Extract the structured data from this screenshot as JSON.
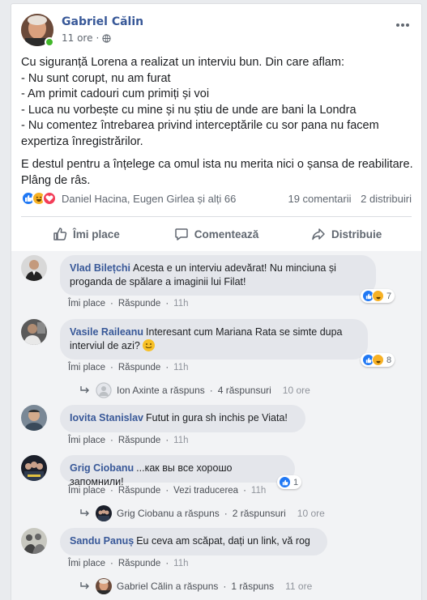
{
  "post": {
    "author": "Gabriel Călin",
    "time": "11 ore",
    "more_icon": "more-dots-icon",
    "body": [
      "Cu siguranță Lorena a realizat un interviu bun. Din care aflam:",
      "- Nu sunt corupt, nu am furat",
      "- Am primit cadouri cum primiți și voi",
      "- Luca nu vorbește cu mine și nu știu de unde are bani la Londra",
      "- Nu comentez întrebarea privind interceptările cu sor pana nu facem",
      "expertiza înregistrărilor."
    ],
    "body2": [
      "E destul pentru a înțelege ca omul ista nu merita nici o șansa de reabilitare.",
      "Plâng de râs."
    ],
    "reactions": {
      "icons": [
        "like",
        "haha",
        "love"
      ],
      "names": "Daniel Hacina, Eugen Girlea și alți 66",
      "comments": "19 comentarii",
      "shares": "2 distribuiri"
    },
    "actions": {
      "like": "Îmi place",
      "comment": "Comentează",
      "share": "Distribuie"
    }
  },
  "comments": [
    {
      "name": "Vlad Bilețchi",
      "text_lines": [
        "Acesta e un interviu adevărat! Nu minciuna și",
        "proganda de spălare a imaginii lui Filat!"
      ],
      "like": "Îmi place",
      "reply": "Răspunde",
      "time": "11h",
      "reaction_count": "7"
    },
    {
      "name": "Vasile Raileanu",
      "text_lines": [
        "Interesant cum Mariana Rata se simte dupa",
        "interviul de azi?"
      ],
      "like": "Îmi place",
      "reply": "Răspunde",
      "time": "11h",
      "reaction_count": "8",
      "replies": {
        "name": "Ion Axinte a răspuns",
        "count": "4 răspunsuri",
        "time": "10 ore"
      }
    },
    {
      "name": "Iovita Stanislav",
      "text_lines": [
        "Futut in gura sh inchis pe Viata!"
      ],
      "like": "Îmi place",
      "reply": "Răspunde",
      "time": "11h"
    },
    {
      "name": "Grig Ciobanu",
      "text_lines": [
        "...как вы все хорошо запомнили!"
      ],
      "like": "Îmi place",
      "reply": "Răspunde",
      "translate": "Vezi traducerea",
      "time": "11h",
      "reaction_count": "1",
      "replies": {
        "name": "Grig Ciobanu a răspuns",
        "count": "2 răspunsuri",
        "time": "10 ore"
      }
    },
    {
      "name": "Sandu Panuș",
      "text_lines": [
        "Eu ceva am scăpat, dați un link, vă rog"
      ],
      "like": "Îmi place",
      "reply": "Răspunde",
      "time": "11h",
      "replies": {
        "name": "Gabriel Călin a răspuns",
        "count": "1 răspuns",
        "time": "11 ore"
      }
    }
  ],
  "colors": {
    "link_blue": "#385898",
    "like_blue": "#2078f4",
    "haha_yellow": "#f7b125",
    "love_red": "#f33e58",
    "online_green": "#42b72a"
  }
}
